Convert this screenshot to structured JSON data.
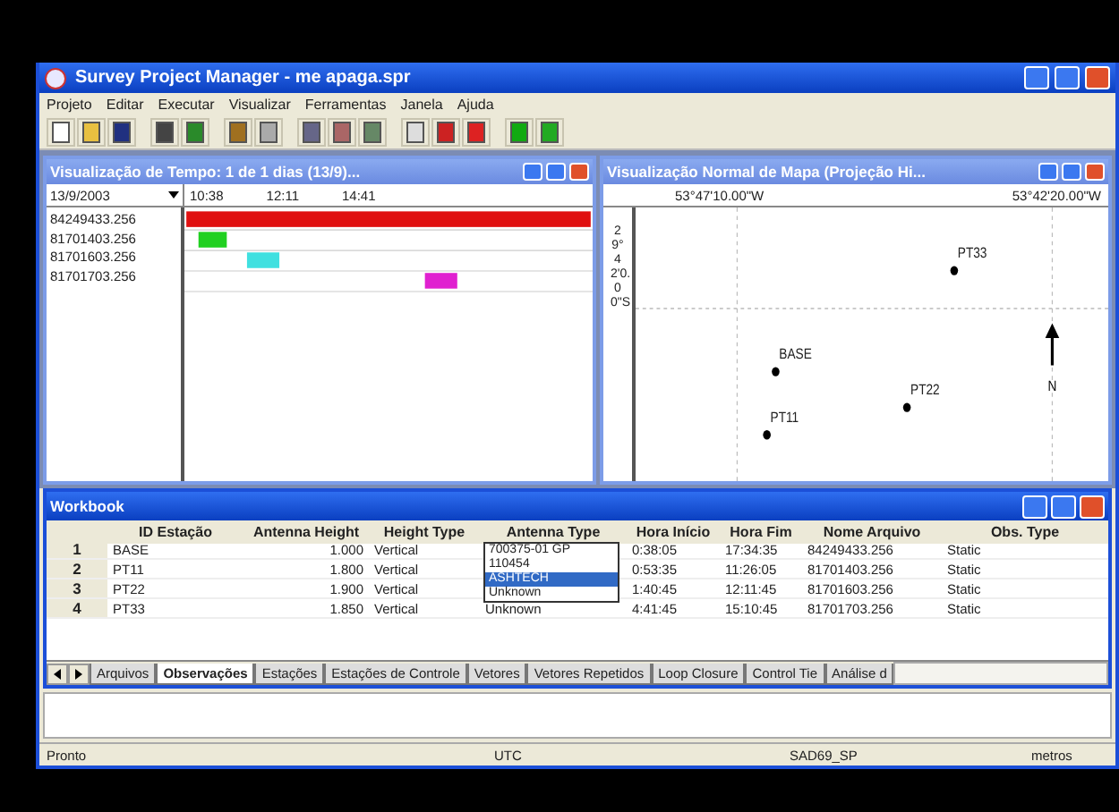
{
  "window": {
    "title": "Survey Project Manager - me apaga.spr"
  },
  "menu": [
    "Projeto",
    "Editar",
    "Executar",
    "Visualizar",
    "Ferramentas",
    "Janela",
    "Ajuda"
  ],
  "time_view": {
    "title": "Visualização de Tempo: 1 de 1 dias (13/9)...",
    "date": "13/9/2003",
    "ticks": [
      "10:38",
      "12:11",
      "14:41"
    ],
    "files": [
      {
        "name": "84249433.256",
        "color": "#e01010"
      },
      {
        "name": "81701403.256",
        "color": "#20d020"
      },
      {
        "name": "81701603.256",
        "color": "#40e0e0"
      },
      {
        "name": "81701703.256",
        "color": "#e020d0"
      }
    ]
  },
  "map_view": {
    "title": "Visualização Normal de Mapa (Projeção Hi...",
    "top_labels": [
      "53°47'10.00\"W",
      "53°42'20.00\"W"
    ],
    "left_label": "29°42'0.00\"S",
    "north": "N",
    "points": [
      "PT33",
      "BASE",
      "PT22",
      "PT11"
    ]
  },
  "workbook": {
    "title": "Workbook",
    "columns": [
      "",
      "ID Estação",
      "Antenna Height",
      "Height Type",
      "Antenna Type",
      "Hora Início",
      "Hora Fim",
      "Nome Arquivo",
      "Obs. Type"
    ],
    "rows": [
      [
        "1",
        "BASE",
        "1.000",
        "Vertical",
        "",
        "0:38:05",
        "17:34:35",
        "84249433.256",
        "Static"
      ],
      [
        "2",
        "PT11",
        "1.800",
        "Vertical",
        "",
        "0:53:35",
        "11:26:05",
        "81701403.256",
        "Static"
      ],
      [
        "3",
        "PT22",
        "1.900",
        "Vertical",
        "",
        "1:40:45",
        "12:11:45",
        "81701603.256",
        "Static"
      ],
      [
        "4",
        "PT33",
        "1.850",
        "Vertical",
        "Unknown",
        "4:41:45",
        "15:10:45",
        "81701703.256",
        "Static"
      ]
    ],
    "dropdown": [
      {
        "label": "700375-01 GP",
        "selected": false
      },
      {
        "label": "110454",
        "selected": false
      },
      {
        "label": "ASHTECH",
        "selected": true
      },
      {
        "label": "Unknown",
        "selected": false
      }
    ],
    "sheet_tabs": [
      {
        "label": "Arquivos",
        "selected": false
      },
      {
        "label": "Observações",
        "selected": true
      },
      {
        "label": "Estações",
        "selected": false
      },
      {
        "label": "Estações de Controle",
        "selected": false
      },
      {
        "label": "Vetores",
        "selected": false
      },
      {
        "label": "Vetores Repetidos",
        "selected": false
      },
      {
        "label": "Loop Closure",
        "selected": false
      },
      {
        "label": "Control Tie",
        "selected": false
      },
      {
        "label": "Análise d",
        "selected": false
      }
    ]
  },
  "status_bar": [
    "Pronto",
    "UTC",
    "SAD69_SP",
    "metros"
  ]
}
